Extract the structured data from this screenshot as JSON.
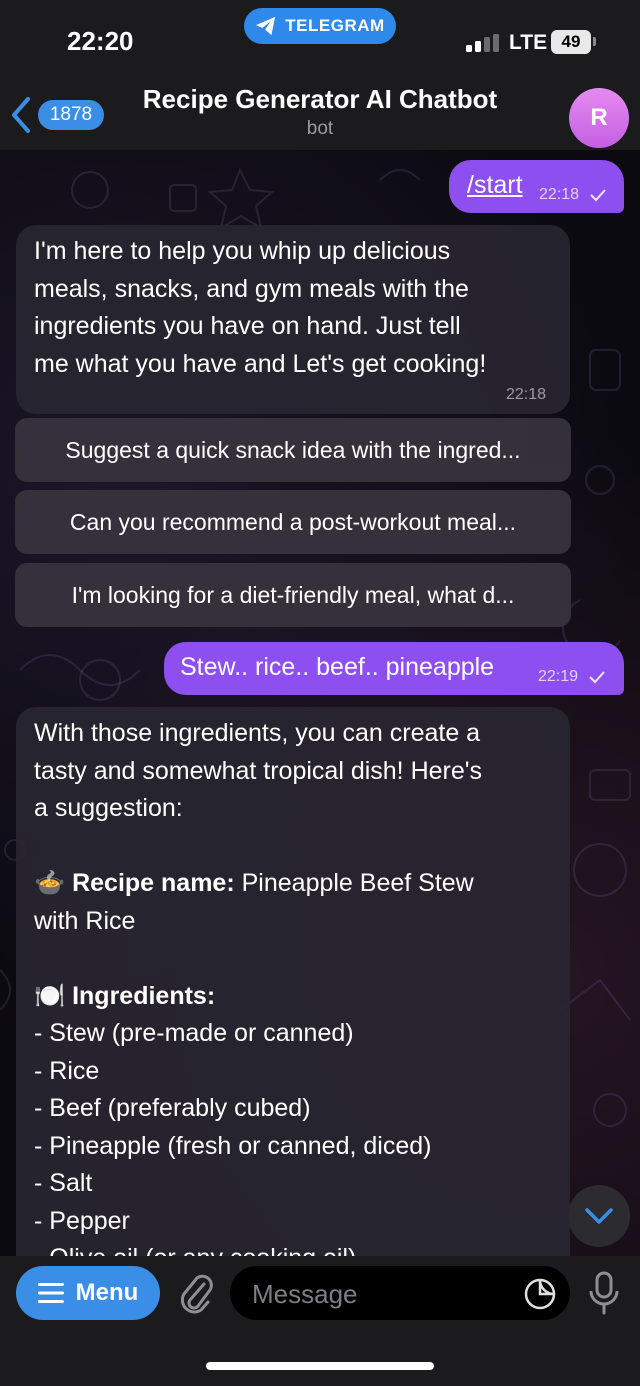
{
  "status_bar": {
    "time": "22:20",
    "app_pill": "TELEGRAM",
    "network": "LTE",
    "battery": "49"
  },
  "header": {
    "unread_count": "1878",
    "title": "Recipe Generator AI Chatbot",
    "subtitle": "bot",
    "avatar_letter": "R"
  },
  "messages": [
    {
      "direction": "outgoing",
      "text": "/start",
      "time": "22:18",
      "status_icon": "check-icon"
    },
    {
      "direction": "incoming",
      "lines": [
        "I'm here to help you whip up delicious",
        "meals, snacks, and gym meals with the",
        "ingredients you have on hand. Just tell",
        "me what you have and Let's get cooking!"
      ],
      "time": "22:18"
    },
    {
      "direction": "outgoing",
      "text": "Stew.. rice.. beef.. pineapple",
      "time": "22:19",
      "status_icon": "check-icon"
    }
  ],
  "keyboard_buttons": [
    "Suggest a quick snack idea with the ingred...",
    "Can you recommend a post-workout meal...",
    "I'm looking for a diet-friendly meal, what d..."
  ],
  "reply": {
    "intro_lines": [
      "With those ingredients, you can create a",
      "tasty and somewhat tropical dish! Here's",
      "a suggestion:"
    ],
    "recipe_emoji": "🍲",
    "recipe_label": "Recipe name",
    "recipe_value_line1": "Pineapple Beef Stew",
    "recipe_value_line2": "with Rice",
    "ingredients_emoji": "🍽️",
    "ingredients_label": "Ingredients",
    "ingredients": [
      "- Stew (pre-made or canned)",
      "- Rice",
      "- Beef (preferably cubed)",
      "- Pineapple (fresh or canned, diced)",
      "- Salt",
      "- Pepper",
      "- Olive oil (or any cooking oil)"
    ]
  },
  "composer": {
    "menu_label": "Menu",
    "placeholder": "Message"
  },
  "colors": {
    "outgoing_bubble": "#8d4ff0",
    "accent": "#3a8ee6",
    "telegram_pill": "#2f89ea"
  }
}
